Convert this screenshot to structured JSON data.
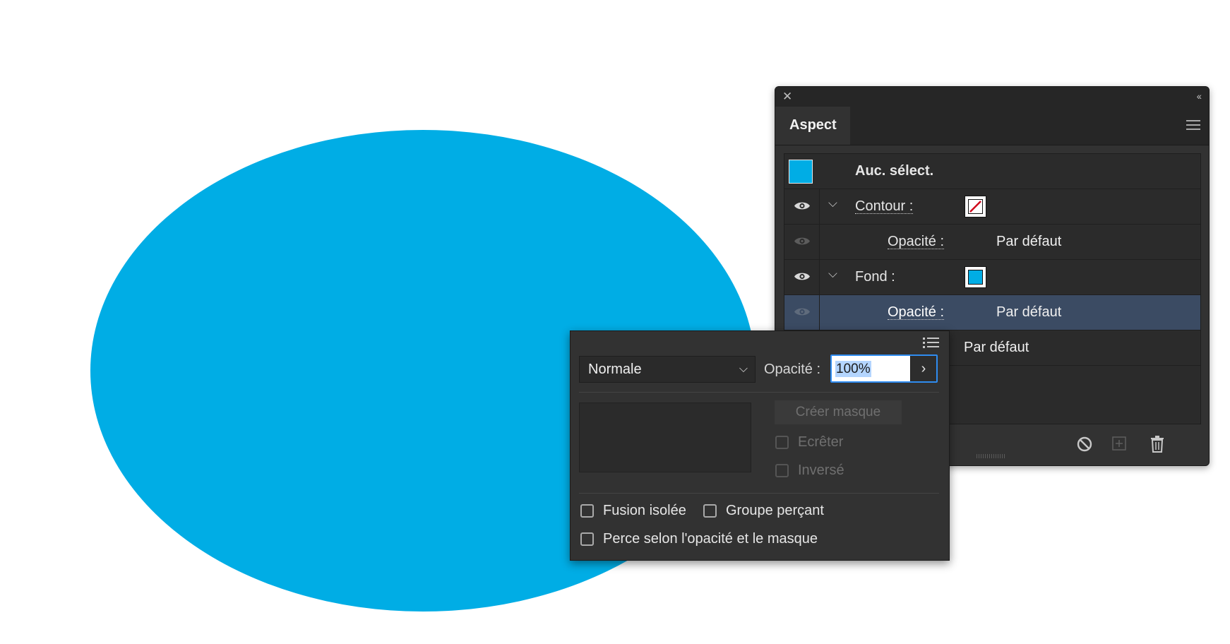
{
  "canvas": {
    "shape_color": "#00ade5"
  },
  "panel": {
    "tab_title": "Aspect",
    "header_row": {
      "label": "Auc. sélect.",
      "swatch_color": "#00ade5"
    },
    "rows": [
      {
        "label": "Contour :",
        "value": ""
      },
      {
        "label": "Opacité :",
        "value": "Par défaut"
      },
      {
        "label": "Fond :",
        "value": ""
      },
      {
        "label": "Opacité :",
        "value": "Par défaut"
      },
      {
        "label": "",
        "value": "Par défaut"
      }
    ],
    "stroke_none_color": "#d0021b",
    "fill_color": "#00ade5",
    "selected_row_color": "#3b4b63"
  },
  "transparency_popup": {
    "blend_mode": "Normale",
    "opacity_label": "Opacité :",
    "opacity_value": "100%",
    "create_mask_label": "Créer masque",
    "clip_label": "Ecrêter",
    "invert_label": "Inversé",
    "isolated_blend_label": "Fusion isolée",
    "knockout_group_label": "Groupe perçant",
    "opacity_mask_knockout_label": "Perce selon l'opacité et le masque"
  }
}
